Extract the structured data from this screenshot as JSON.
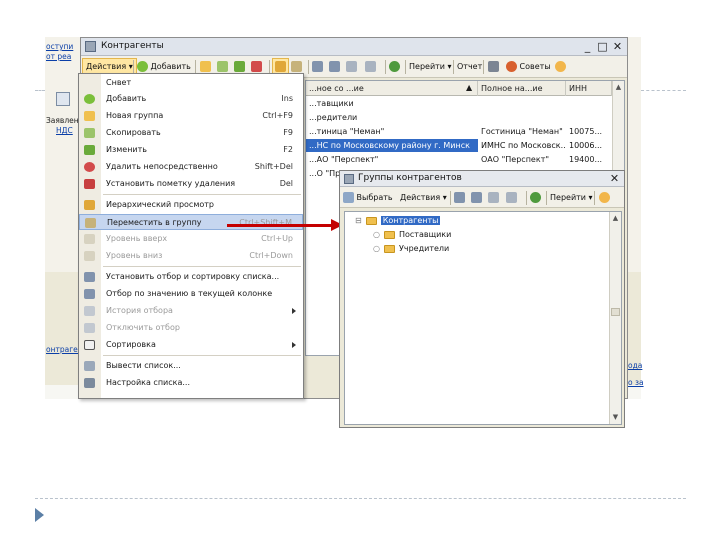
{
  "background": {
    "left_links": [
      "оступи",
      "от реа",
      "Заявлен",
      "НДС",
      "онтрагенты"
    ],
    "right_links": [
      "ода",
      "о за"
    ]
  },
  "main_window": {
    "title": "Контрагенты",
    "window_buttons": [
      "_",
      "□",
      "✕"
    ],
    "toolbar": {
      "actions": "Действия",
      "add": "Добавить",
      "goto": "Перейти",
      "report": "Отчет",
      "tips": "Советы"
    },
    "table": {
      "columns": [
        "...ное со ...ие",
        "Полное на...ие",
        "ИНН"
      ],
      "rows": [
        {
          "name": "...тавщики",
          "full": "",
          "inn": ""
        },
        {
          "name": "...редители",
          "full": "",
          "inn": ""
        },
        {
          "name": "...тиница \"Неман\"",
          "full": "Гостиница \"Неман\"",
          "inn": "10075..."
        },
        {
          "name": "...НС по Московскому району г. Минск",
          "full": "ИМНС по Московск...",
          "inn": "10006..."
        },
        {
          "name": "...АО \"Перспект\"",
          "full": "ОАО \"Перспект\"",
          "inn": "19400..."
        },
        {
          "name": "...О \"Продо...",
          "full": "",
          "inn": ""
        }
      ]
    }
  },
  "menu": {
    "items": [
      {
        "label": "Cнвет",
        "shortcut": "",
        "icon": "blank"
      },
      {
        "label": "Добавить",
        "shortcut": "Ins",
        "icon": "add-icon"
      },
      {
        "label": "Новая группа",
        "shortcut": "Ctrl+F9",
        "icon": "new-group-icon"
      },
      {
        "label": "Скопировать",
        "shortcut": "F9",
        "icon": "copy-icon"
      },
      {
        "label": "Изменить",
        "shortcut": "F2",
        "icon": "edit-icon"
      },
      {
        "label": "Удалить непосредственно",
        "shortcut": "Shift+Del",
        "icon": "delete-icon"
      },
      {
        "label": "Установить пометку удаления",
        "shortcut": "Del",
        "icon": "mark-delete-icon"
      },
      {
        "label": "Иерархический просмотр",
        "shortcut": "",
        "icon": "hierarchy-icon"
      },
      {
        "label": "Переместить в группу",
        "shortcut": "Ctrl+Shift+M",
        "icon": "move-to-group-icon"
      },
      {
        "label": "Уровень вверх",
        "shortcut": "Ctrl+Up",
        "icon": "level-up-icon"
      },
      {
        "label": "Уровень вниз",
        "shortcut": "Ctrl+Down",
        "icon": "level-down-icon"
      },
      {
        "label": "Установить отбор и сортировку списка...",
        "shortcut": "",
        "icon": "filter-sort-icon"
      },
      {
        "label": "Отбор по значению в текущей колонке",
        "shortcut": "",
        "icon": "filter-value-icon"
      },
      {
        "label": "История отбора",
        "shortcut": "",
        "icon": "filter-history-icon"
      },
      {
        "label": "Отключить отбор",
        "shortcut": "",
        "icon": "filter-off-icon"
      },
      {
        "label": "Сортировка",
        "shortcut": "",
        "icon": "sort-icon"
      },
      {
        "label": "Вывести список...",
        "shortcut": "",
        "icon": "print-list-icon"
      },
      {
        "label": "Настройка списка...",
        "shortcut": "",
        "icon": "list-settings-icon"
      }
    ]
  },
  "dialog": {
    "title": "Группы контрагентов",
    "toolbar": {
      "select": "Выбрать",
      "actions": "Действия",
      "goto": "Перейти"
    },
    "tree": {
      "root": "Контрагенты",
      "children": [
        "Поставщики",
        "Учредители"
      ]
    }
  }
}
